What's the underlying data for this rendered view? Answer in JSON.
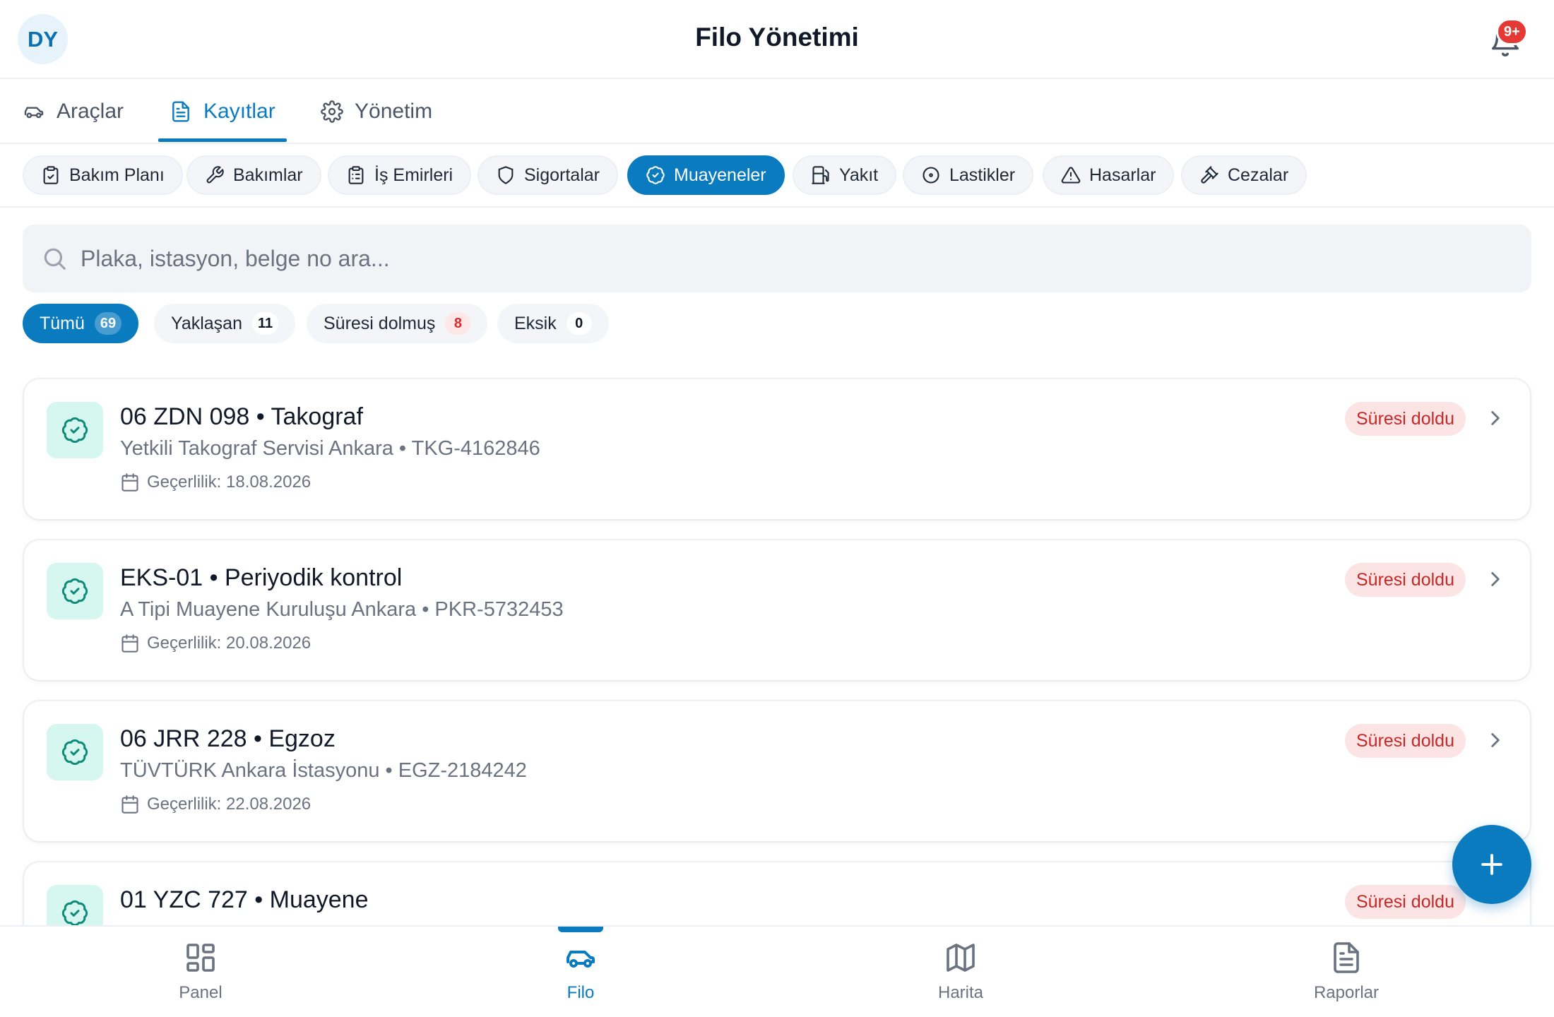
{
  "header": {
    "avatar_initials": "DY",
    "title": "Filo Yönetimi",
    "notification_badge": "9+"
  },
  "tabs": [
    {
      "label": "Araçlar",
      "icon": "car-icon"
    },
    {
      "label": "Kayıtlar",
      "icon": "document-icon",
      "active": true
    },
    {
      "label": "Yönetim",
      "icon": "gear-icon"
    }
  ],
  "chips": [
    {
      "label": "Bakım Planı",
      "icon": "clipboard-icon"
    },
    {
      "label": "Bakımlar",
      "icon": "wrench-icon"
    },
    {
      "label": "İş Emirleri",
      "icon": "clipboard-list-icon"
    },
    {
      "label": "Sigortalar",
      "icon": "shield-icon"
    },
    {
      "label": "Muayeneler",
      "icon": "badge-check-icon",
      "active": true
    },
    {
      "label": "Yakıt",
      "icon": "fuel-icon"
    },
    {
      "label": "Lastikler",
      "icon": "tire-icon"
    },
    {
      "label": "Hasarlar",
      "icon": "warning-icon"
    },
    {
      "label": "Cezalar",
      "icon": "gavel-icon"
    }
  ],
  "search": {
    "placeholder": "Plaka, istasyon, belge no ara..."
  },
  "filters": [
    {
      "label": "Tümü",
      "count": "69",
      "active": true
    },
    {
      "label": "Yaklaşan",
      "count": "11"
    },
    {
      "label": "Süresi dolmuş",
      "count": "8",
      "alert": true
    },
    {
      "label": "Eksik",
      "count": "0"
    }
  ],
  "records": [
    {
      "title": "06 ZDN 098 • Takograf",
      "subtitle": "Yetkili Takograf Servisi Ankara • TKG-4162846",
      "validity": "Geçerlilik: 18.08.2026",
      "status": "Süresi doldu"
    },
    {
      "title": "EKS-01 • Periyodik kontrol",
      "subtitle": "A Tipi Muayene Kuruluşu Ankara • PKR-5732453",
      "validity": "Geçerlilik: 20.08.2026",
      "status": "Süresi doldu"
    },
    {
      "title": "06 JRR 228 • Egzoz",
      "subtitle": "TÜVTÜRK Ankara İstasyonu • EGZ-2184242",
      "validity": "Geçerlilik: 22.08.2026",
      "status": "Süresi doldu"
    },
    {
      "title": "01 YZC 727 • Muayene",
      "subtitle": "",
      "validity": "",
      "status": "Süresi doldu"
    }
  ],
  "bottom_nav": [
    {
      "label": "Panel",
      "icon": "grid-icon"
    },
    {
      "label": "Filo",
      "icon": "car-icon",
      "active": true
    },
    {
      "label": "Harita",
      "icon": "map-icon"
    },
    {
      "label": "Raporlar",
      "icon": "report-icon"
    }
  ],
  "colors": {
    "primary": "#0b7bc0",
    "expired_bg": "#fde4e4",
    "expired_text": "#c62828",
    "icon_bg": "#d6f7ef",
    "icon_stroke": "#0e8a78"
  }
}
